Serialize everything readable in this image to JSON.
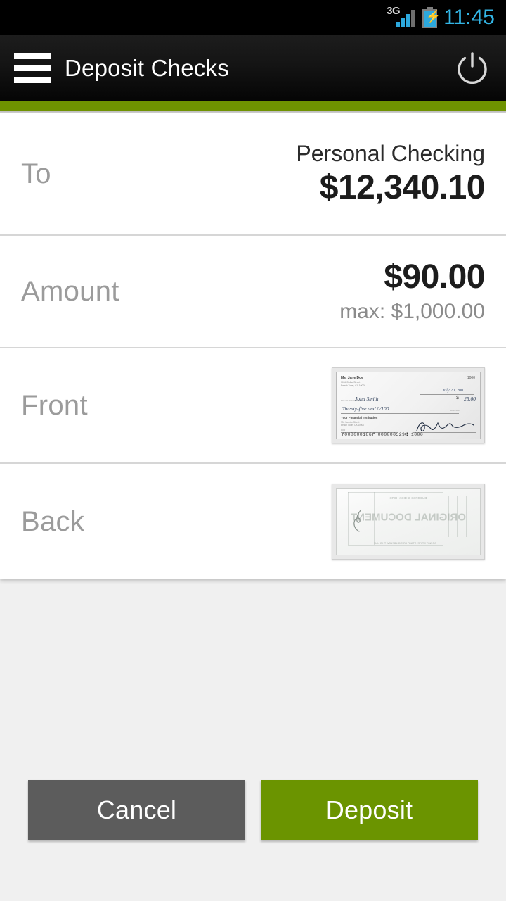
{
  "status_bar": {
    "network_label": "3G",
    "network_icon": "signal-bars-icon",
    "battery_icon": "battery-charging-icon",
    "clock": "11:45",
    "accent_color": "#33b5e5"
  },
  "action_bar": {
    "menu_icon": "hamburger-menu-icon",
    "title": "Deposit Checks",
    "power_icon": "power-icon",
    "accent_color": "#6f9300"
  },
  "form": {
    "rows": [
      {
        "label": "To",
        "account_name": "Personal Checking",
        "account_balance": "$12,340.10"
      },
      {
        "label": "Amount",
        "amount": "$90.00",
        "max_label": "max: $1,000.00"
      },
      {
        "label": "Front",
        "thumbnail": "check-front-image"
      },
      {
        "label": "Back",
        "thumbnail": "check-back-image"
      }
    ]
  },
  "check_front": {
    "payer_name": "Ms. Jane Doe",
    "payer_address_line1": "1004 Dollar Street",
    "payer_address_line2": "Beach Town, CA 10000",
    "check_number": "1000",
    "date": "July 20, 200",
    "pay_to_label": "PAY TO THE ORDER OF",
    "payee": "John Smith",
    "dollar_symbol": "$",
    "amount_numeric": "25.00",
    "amount_words": "Twenty-five and 0/100",
    "dollars_label": "DOLLARS",
    "bank_name": "Your Financial Institution",
    "bank_address_line1": "994 Sunrise Street",
    "bank_address_line2": "Beach Town, CA 10000",
    "memo_label": "FOR",
    "micr_line": "⑈000000186⑈ 000000529⑆ 1000"
  },
  "check_back": {
    "watermark": "ORIGINAL DOCUMENT",
    "top_text": "ENDORSE CHECK HERE",
    "endorse_note": "DO NOT WRITE, STAMP OR SIGN BELOW THIS LINE"
  },
  "buttons": {
    "cancel_label": "Cancel",
    "cancel_color": "#5c5c5c",
    "deposit_label": "Deposit",
    "deposit_color": "#6b9400"
  }
}
